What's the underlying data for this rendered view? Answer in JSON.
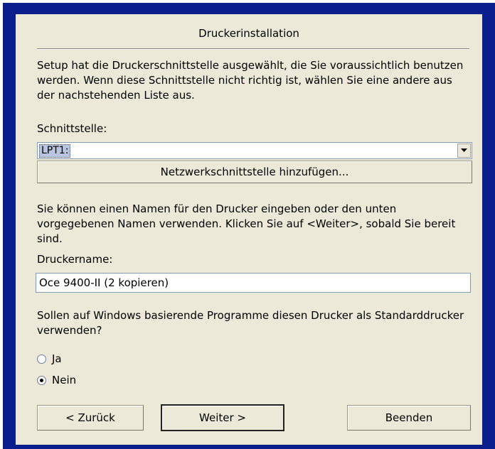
{
  "dialog": {
    "title": "Druckerinstallation",
    "intro": "Setup hat die Druckerschnittstelle ausgewählt, die Sie voraussichtlich benutzen werden. Wenn diese Schnittstelle nicht richtig ist, wählen Sie eine andere aus der nachstehenden Liste aus.",
    "port_label": "Schnittstelle:",
    "port_value": "LPT1:",
    "add_network_port": "Netzwerkschnittstelle hinzufügen...",
    "name_intro": "Sie können einen Namen für den Drucker eingeben oder den unten vorgegebenen Namen verwenden. Klicken Sie auf <Weiter>, sobald Sie bereit sind.",
    "name_label": "Druckername:",
    "name_value": "Oce 9400-II (2  kopieren)",
    "default_question": "Sollen auf Windows basierende Programme diesen Drucker als Standarddrucker verwenden?",
    "options": [
      {
        "label": "Ja",
        "selected": false
      },
      {
        "label": "Nein",
        "selected": true
      }
    ],
    "buttons": {
      "back": "< Zurück",
      "next": "Weiter >",
      "cancel": "Beenden"
    }
  },
  "icons": {
    "combo_arrow": "chevron-down-icon"
  }
}
